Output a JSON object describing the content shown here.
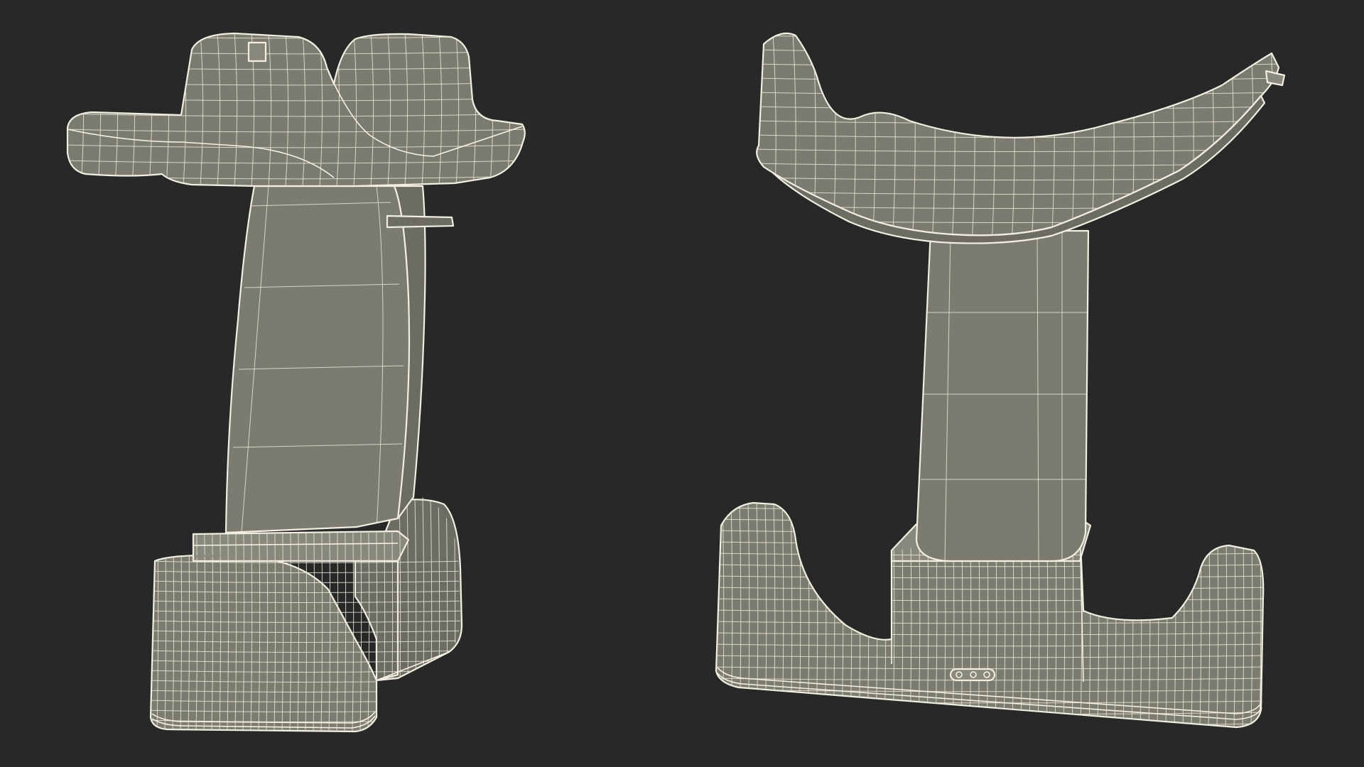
{
  "scene": {
    "background_color": "#282828",
    "surface_color": "#7b7b70",
    "wire_color": "#f1efe1",
    "render_style": "wireframe-over-shaded"
  },
  "objects": [
    {
      "name": "stand-view-angled"
    },
    {
      "name": "stand-view-front"
    }
  ]
}
